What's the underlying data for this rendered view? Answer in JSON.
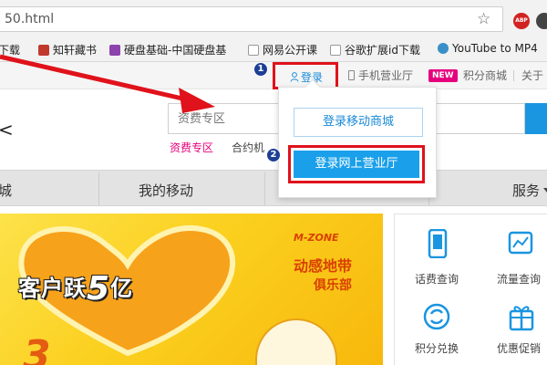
{
  "browser": {
    "url": "50.html",
    "star_icon": "star-icon",
    "extensions": {
      "adblock_label": "ABP"
    }
  },
  "bookmarks": [
    {
      "label": "下载",
      "icon": "download-icon"
    },
    {
      "label": "知轩藏书",
      "icon": "book-site-icon",
      "color": "#c0392b"
    },
    {
      "label": "硬盘基础-中国硬盘基",
      "icon": "grid-site-icon",
      "color": "#8e44ad"
    },
    {
      "label": "网易公开课",
      "icon": "page-icon"
    },
    {
      "label": "谷歌扩展id下载",
      "icon": "page-icon"
    },
    {
      "label": "YouTube to MP4",
      "icon": "swirl-icon"
    }
  ],
  "topbar": {
    "login": "登录",
    "phone_hall": "手机营业厅",
    "new_badge": "NEW",
    "points_mall": "积分商城",
    "about": "关于"
  },
  "search": {
    "placeholder": "资费专区",
    "hot_links": [
      "资费专区",
      "合约机"
    ]
  },
  "logo_fragment": "<",
  "nav": {
    "items": [
      "城",
      "我的移动",
      "服务"
    ]
  },
  "dropdown": {
    "login_mall": "登录移动商城",
    "login_hall": "登录网上营业厅"
  },
  "steps": [
    "1",
    "2"
  ],
  "banner": {
    "headline_prefix": "客户跃",
    "headline_number": "5",
    "headline_suffix": "亿",
    "mzone_en": "M-ZONE",
    "mzone_cn": "动感地带",
    "club": "俱乐部",
    "big_digit": "3"
  },
  "services": [
    {
      "label": "话费查询",
      "icon": "phone-bill-icon"
    },
    {
      "label": "流量查询",
      "icon": "data-chart-icon"
    },
    {
      "label": "积分兑换",
      "icon": "refresh-exchange-icon"
    },
    {
      "label": "优惠促销",
      "icon": "gift-icon"
    }
  ],
  "colors": {
    "annotation_red": "#e0121b",
    "accent_blue": "#1a95e0",
    "new_pink": "#e6007e",
    "step_blue": "#1d3f94"
  }
}
